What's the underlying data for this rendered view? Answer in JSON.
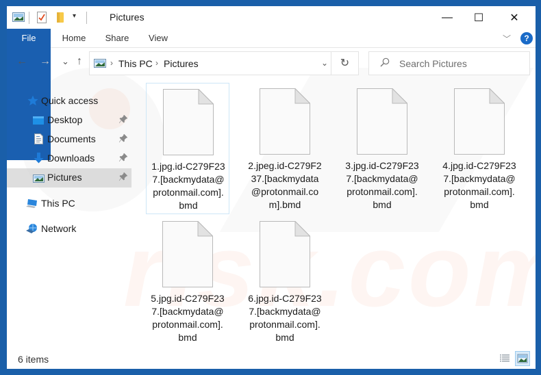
{
  "window": {
    "title": "Pictures",
    "controls": {
      "minimize": "—",
      "maximize": "☐",
      "close": "✕"
    }
  },
  "quick_access_toolbar": {
    "icons": [
      "pictures-icon",
      "properties-icon",
      "new-folder-icon",
      "customize-dropdown-icon"
    ],
    "dropdown_glyph": "▾"
  },
  "ribbon": {
    "tabs": [
      {
        "label": "File",
        "active": true
      },
      {
        "label": "Home"
      },
      {
        "label": "Share"
      },
      {
        "label": "View"
      }
    ],
    "expand_glyph": "﹀",
    "help_glyph": "?"
  },
  "nav": {
    "back": "←",
    "forward": "→",
    "recent": "⌄",
    "up": "↑",
    "breadcrumb": [
      "This PC",
      "Pictures"
    ],
    "crumb_sep": "›",
    "dropdown": "⌄",
    "refresh": "↻",
    "search_placeholder": "Search Pictures",
    "search_glyph": "⚲"
  },
  "sidebar": {
    "items": [
      {
        "label": "Quick access",
        "icon": "star-icon"
      },
      {
        "label": "Desktop",
        "icon": "desktop-icon",
        "pinned": true
      },
      {
        "label": "Documents",
        "icon": "documents-icon",
        "pinned": true
      },
      {
        "label": "Downloads",
        "icon": "downloads-icon",
        "pinned": true
      },
      {
        "label": "Pictures",
        "icon": "pictures-icon",
        "pinned": true,
        "selected": true
      },
      {
        "label": "This PC",
        "icon": "computer-icon"
      },
      {
        "label": "Network",
        "icon": "network-icon"
      }
    ],
    "pin_glyph": "📌"
  },
  "files": [
    {
      "name": "1.jpg.id-C279F23\n7.[backmydata@\nprotonmail.com].\nbmd"
    },
    {
      "name": "2.jpeg.id-C279F2\n37.[backmydata\n@protonmail.co\nm].bmd"
    },
    {
      "name": "3.jpg.id-C279F23\n7.[backmydata@\nprotonmail.com].\nbmd"
    },
    {
      "name": "4.jpg.id-C279F23\n7.[backmydata@\nprotonmail.com].\nbmd"
    },
    {
      "name": "5.jpg.id-C279F23\n7.[backmydata@\nprotonmail.com].\nbmd"
    },
    {
      "name": "6.jpg.id-C279F23\n7.[backmydata@\nprotonmail.com].\nbmd"
    }
  ],
  "status": {
    "item_count": "6 items",
    "views": [
      "details-view",
      "large-icons-view"
    ],
    "active_view": "large-icons-view"
  },
  "watermark": {
    "text": "risk.com"
  },
  "colors": {
    "frame": "#1a5fa9",
    "file_tab": "#1a5fb0",
    "help": "#1a6bc8",
    "selected": "#cdcdcd",
    "hover_border": "#cde6f7"
  }
}
